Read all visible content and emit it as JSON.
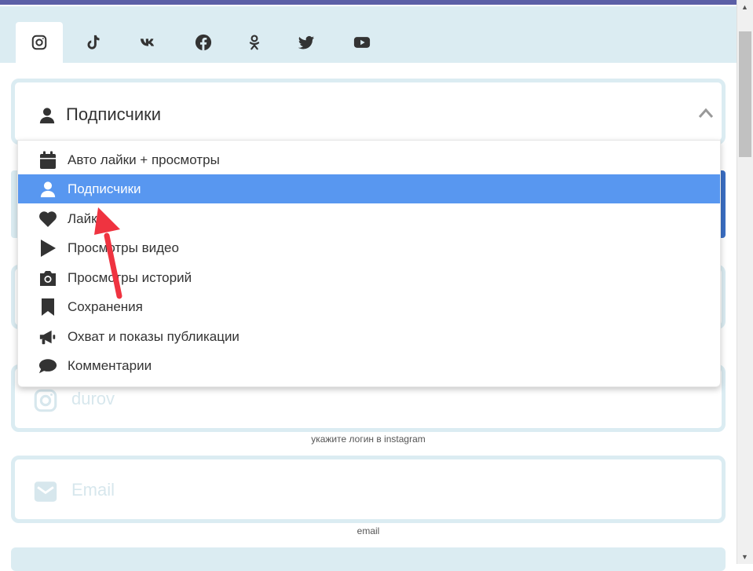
{
  "social_tabs": [
    {
      "name": "instagram",
      "icon": "instagram-icon",
      "active": true
    },
    {
      "name": "tiktok",
      "icon": "tiktok-icon",
      "active": false
    },
    {
      "name": "vk",
      "icon": "vk-icon",
      "active": false
    },
    {
      "name": "facebook",
      "icon": "facebook-icon",
      "active": false
    },
    {
      "name": "odnoklassniki",
      "icon": "odnoklassniki-icon",
      "active": false
    },
    {
      "name": "twitter",
      "icon": "twitter-icon",
      "active": false
    },
    {
      "name": "youtube",
      "icon": "youtube-icon",
      "active": false
    }
  ],
  "service_select": {
    "selected_label": "Подписчики",
    "selected_icon": "user-icon",
    "options": [
      {
        "label": "Авто лайки + просмотры",
        "icon": "calendar-icon",
        "selected": false
      },
      {
        "label": "Подписчики",
        "icon": "user-icon",
        "selected": true
      },
      {
        "label": "Лайки",
        "icon": "heart-icon",
        "selected": false
      },
      {
        "label": "Просмотры видео",
        "icon": "play-icon",
        "selected": false
      },
      {
        "label": "Просмотры историй",
        "icon": "camera-icon",
        "selected": false
      },
      {
        "label": "Сохранения",
        "icon": "bookmark-icon",
        "selected": false
      },
      {
        "label": "Охват и показы публикации",
        "icon": "megaphone-icon",
        "selected": false
      },
      {
        "label": "Комментарии",
        "icon": "comment-icon",
        "selected": false
      }
    ]
  },
  "login_field": {
    "placeholder": "durov",
    "hint": "укажите логин в instagram",
    "icon": "instagram-icon"
  },
  "email_field": {
    "placeholder": "Email",
    "hint": "email",
    "icon": "envelope-icon"
  },
  "colors": {
    "accent_light": "#dbecf2",
    "highlight": "#5897f0",
    "arrow": "#ef3340",
    "header_bar": "#5b5fa6"
  }
}
